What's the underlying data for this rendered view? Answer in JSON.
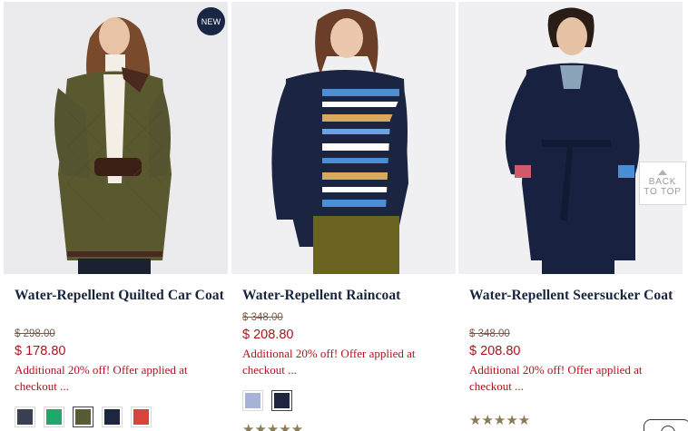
{
  "products": [
    {
      "name": "Water-Repellent Quilted Car Coat",
      "badge": "NEW",
      "old_price": "$ 298.00",
      "price": "$ 178.80",
      "promo": "Additional 20% off! Offer applied at checkout ...",
      "swatches": [
        {
          "color": "#3a3f52",
          "selected": false
        },
        {
          "color": "#1fa869",
          "selected": false
        },
        {
          "color": "#5a5a34",
          "selected": true
        },
        {
          "color": "#1d2540",
          "selected": false
        },
        {
          "color": "#d7453a",
          "selected": false
        }
      ],
      "background": "#ebebed"
    },
    {
      "name": "Water-Repellent Raincoat",
      "old_price": "$ 348.00",
      "price": "$ 208.80",
      "promo": "Additional 20% off! Offer applied at checkout ...",
      "swatches": [
        {
          "color": "#a6b3d6",
          "selected": false
        },
        {
          "color": "#1d2540",
          "selected": true
        }
      ],
      "rating_stars": "★★★★★",
      "background": "#f0f0f2"
    },
    {
      "name": "Water-Repellent Seersucker Coat",
      "old_price": "$ 348.00",
      "price": "$ 208.80",
      "promo": "Additional 20% off! Offer applied at checkout ...",
      "rating_stars": "★★★★★",
      "background": "#f0f0f2"
    }
  ],
  "back_to_top": {
    "line1": "BACK",
    "line2": "TO TOP"
  },
  "chat_icon": "chat-bubble-icon",
  "colors": {
    "navy": "#16243d",
    "sale_red": "#b0121c",
    "star": "#8a7a55"
  }
}
